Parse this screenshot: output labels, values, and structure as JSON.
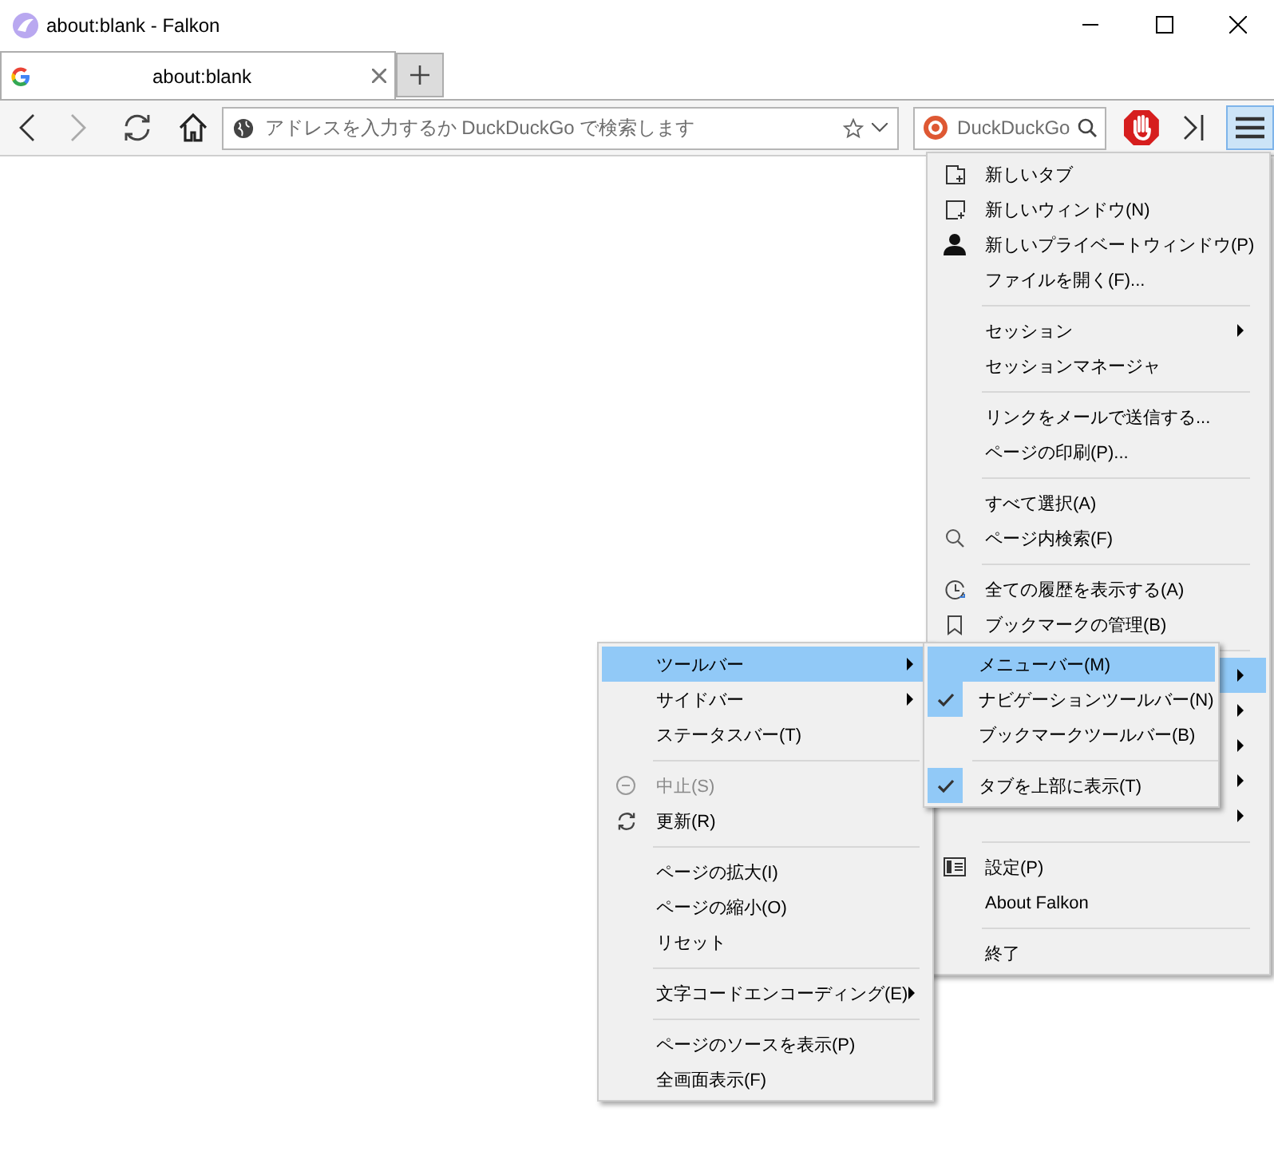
{
  "window": {
    "title": "about:blank - Falkon"
  },
  "tabs": [
    {
      "title": "about:blank",
      "selected": true
    }
  ],
  "address_bar": {
    "placeholder": "アドレスを入力するか DuckDuckGo で検索します"
  },
  "search_bar": {
    "placeholder": "DuckDuckGo"
  },
  "main_menu": {
    "items": [
      {
        "kind": "item",
        "label": "新しいタブ"
      },
      {
        "kind": "item",
        "label": "新しいウィンドウ(N)"
      },
      {
        "kind": "item",
        "label": "新しいプライベートウィンドウ(P)"
      },
      {
        "kind": "item",
        "label": "ファイルを開く(F)..."
      },
      {
        "kind": "separator"
      },
      {
        "kind": "submenu",
        "label": "セッション",
        "selected": false
      },
      {
        "kind": "item",
        "label": "セッションマネージャ"
      },
      {
        "kind": "separator"
      },
      {
        "kind": "item",
        "label": "リンクをメールで送信する..."
      },
      {
        "kind": "item",
        "label": "ページの印刷(P)..."
      },
      {
        "kind": "separator"
      },
      {
        "kind": "item",
        "label": "すべて選択(A)"
      },
      {
        "kind": "item",
        "label": "ページ内検索(F)"
      },
      {
        "kind": "separator"
      },
      {
        "kind": "item",
        "label": "全ての履歴を表示する(A)"
      },
      {
        "kind": "item",
        "label": "ブックマークの管理(B)"
      },
      {
        "kind": "separator"
      },
      {
        "kind": "submenu",
        "selected": true
      },
      {
        "kind": "submenu",
        "selected": false
      },
      {
        "kind": "submenu",
        "selected": false
      },
      {
        "kind": "submenu",
        "selected": false
      },
      {
        "kind": "submenu",
        "selected": false
      },
      {
        "kind": "separator"
      },
      {
        "kind": "item",
        "label": "設定(P)"
      },
      {
        "kind": "item",
        "label": "About Falkon"
      },
      {
        "kind": "separator"
      },
      {
        "kind": "item",
        "label": "終了"
      }
    ]
  },
  "view_menu": {
    "items": [
      {
        "kind": "submenu",
        "label": "ツールバー",
        "selected": true
      },
      {
        "kind": "submenu",
        "label": "サイドバー",
        "selected": false
      },
      {
        "kind": "item",
        "label": "ステータスバー(T)",
        "disabled": false
      },
      {
        "kind": "separator"
      },
      {
        "kind": "item",
        "label": "中止(S)",
        "disabled": true
      },
      {
        "kind": "item",
        "label": "更新(R)",
        "disabled": false
      },
      {
        "kind": "separator"
      },
      {
        "kind": "item",
        "label": "ページの拡大(I)",
        "disabled": false
      },
      {
        "kind": "item",
        "label": "ページの縮小(O)",
        "disabled": false
      },
      {
        "kind": "item",
        "label": "リセット",
        "disabled": false
      },
      {
        "kind": "separator"
      },
      {
        "kind": "submenu",
        "label": "文字コードエンコーディング(E)",
        "selected": false
      },
      {
        "kind": "separator"
      },
      {
        "kind": "item",
        "label": "ページのソースを表示(P)",
        "disabled": false
      },
      {
        "kind": "item",
        "label": "全画面表示(F)",
        "disabled": false
      }
    ]
  },
  "toolbars_menu": {
    "items": [
      {
        "kind": "check",
        "label": "メニューバー(M)",
        "checked": false,
        "selected": true
      },
      {
        "kind": "check",
        "label": "ナビゲーションツールバー(N)",
        "checked": true,
        "selected": false
      },
      {
        "kind": "check",
        "label": "ブックマークツールバー(B)",
        "checked": false,
        "selected": false
      },
      {
        "kind": "separator"
      },
      {
        "kind": "check",
        "label": "タブを上部に表示(T)",
        "checked": true,
        "selected": false
      }
    ]
  }
}
